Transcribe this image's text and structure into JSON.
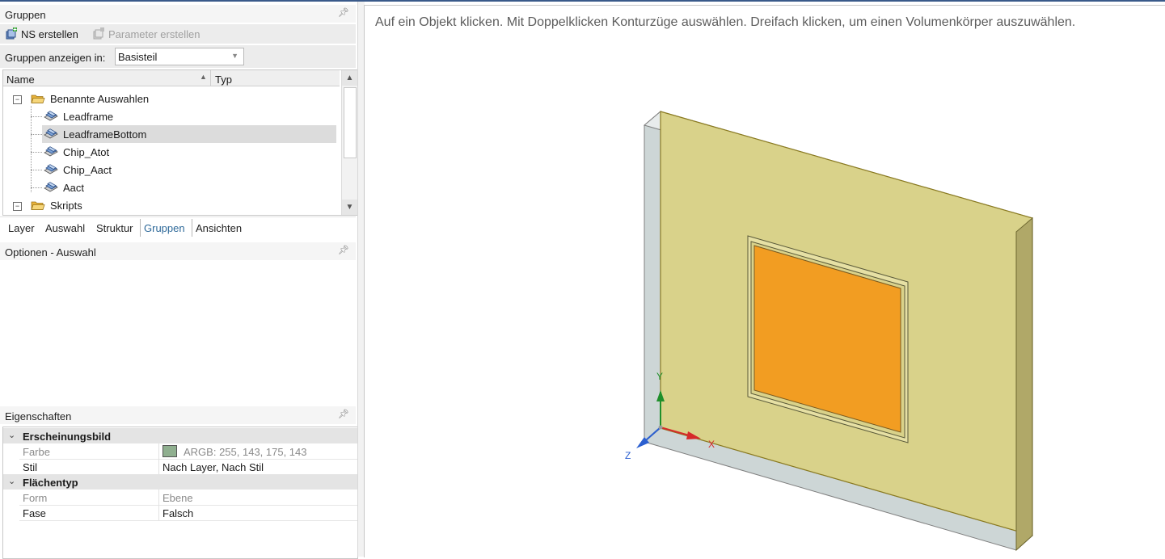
{
  "groups_panel": {
    "title": "Gruppen",
    "toolbar": {
      "ns_create": "NS erstellen",
      "param_create": "Parameter erstellen"
    },
    "show_in_label": "Gruppen anzeigen in:",
    "show_in_value": "Basisteil",
    "columns": {
      "name": "Name",
      "type": "Typ"
    },
    "tree": {
      "named_selections": "Benannte Auswahlen",
      "items": [
        "Leadframe",
        "LeadframeBottom",
        "Chip_Atot",
        "Chip_Aact",
        "Aact"
      ],
      "selected": "LeadframeBottom",
      "scripts": "Skripts"
    }
  },
  "tabs": [
    "Layer",
    "Auswahl",
    "Struktur",
    "Gruppen",
    "Ansichten"
  ],
  "active_tab": "Gruppen",
  "options_panel": {
    "title": "Optionen - Auswahl"
  },
  "properties_panel": {
    "title": "Eigenschaften",
    "appearance": {
      "category": "Erscheinungsbild",
      "color_label": "Farbe",
      "color_value": "ARGB: 255, 143, 175, 143",
      "swatch_color": "#8faf8f",
      "style_label": "Stil",
      "style_value": "Nach Layer, Nach Stil"
    },
    "surface": {
      "category": "Flächentyp",
      "form_label": "Form",
      "form_value": "Ebene",
      "chamfer_label": "Fase",
      "chamfer_value": "Falsch"
    }
  },
  "viewport": {
    "hint": "Auf ein Objekt klicken. Mit Doppelklicken Konturzüge auswählen. Dreifach klicken, um einen Volumenkörper auszuwählen.",
    "axes": {
      "x": "X",
      "y": "Y",
      "z": "Z"
    },
    "colors": {
      "plate_face": "#d9d28a",
      "plate_side": "#b0a868",
      "chip": "#f29d22",
      "axis_x": "#d62a2a",
      "axis_y": "#1f8f2a",
      "axis_z": "#2b5fd0"
    }
  }
}
